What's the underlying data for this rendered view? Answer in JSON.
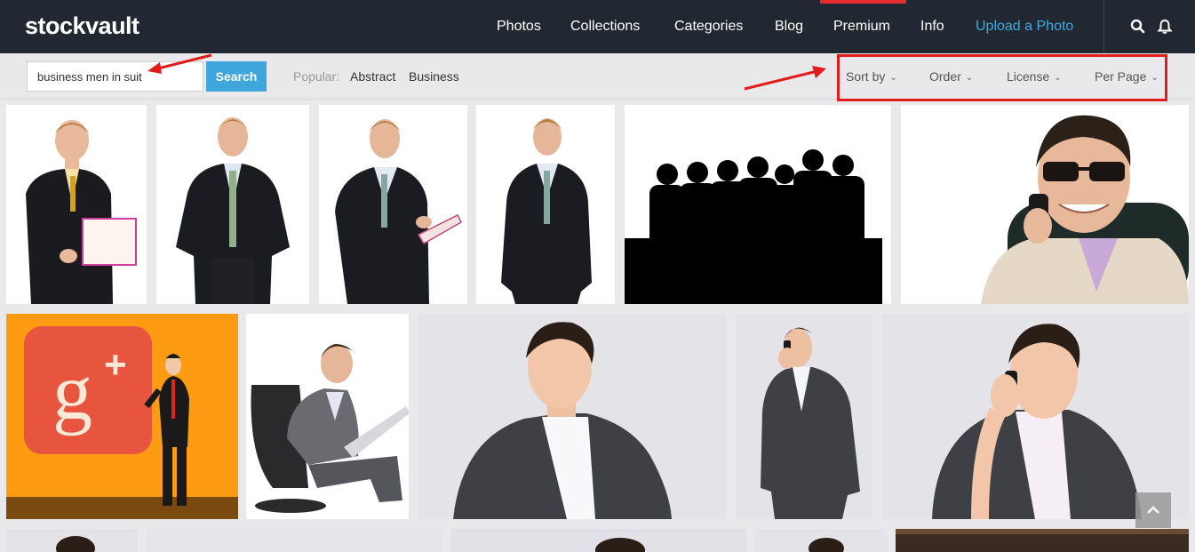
{
  "header": {
    "logo": "stockvault",
    "nav": [
      "Photos",
      "Collections",
      "Categories",
      "Blog",
      "Premium",
      "Info",
      "Upload a Photo"
    ],
    "active_item": "Premium",
    "accent_color": "#3fa9e4",
    "premium_bar_color": "#e52b2b"
  },
  "search": {
    "query": "business men in suit",
    "button_label": "Search",
    "popular_label": "Popular:",
    "popular_links": [
      "Abstract",
      "Business"
    ]
  },
  "filters": [
    "Sort by",
    "Order",
    "License",
    "Per Page"
  ],
  "annotation_color": "#e21b1b",
  "photos": [
    {
      "subject": "man-with-clipboard"
    },
    {
      "subject": "man-hands-on-hips"
    },
    {
      "subject": "man-writing-on-clipboard"
    },
    {
      "subject": "man-standing-hands-in-pockets"
    },
    {
      "subject": "group-silhouette"
    },
    {
      "subject": "man-with-sunglasses-on-phone"
    },
    {
      "subject": "google-plus-illustration"
    },
    {
      "subject": "man-on-laptop-in-chair"
    },
    {
      "subject": "man-portrait-gray-suit"
    },
    {
      "subject": "man-on-phone-standing"
    },
    {
      "subject": "man-on-phone-portrait"
    }
  ]
}
